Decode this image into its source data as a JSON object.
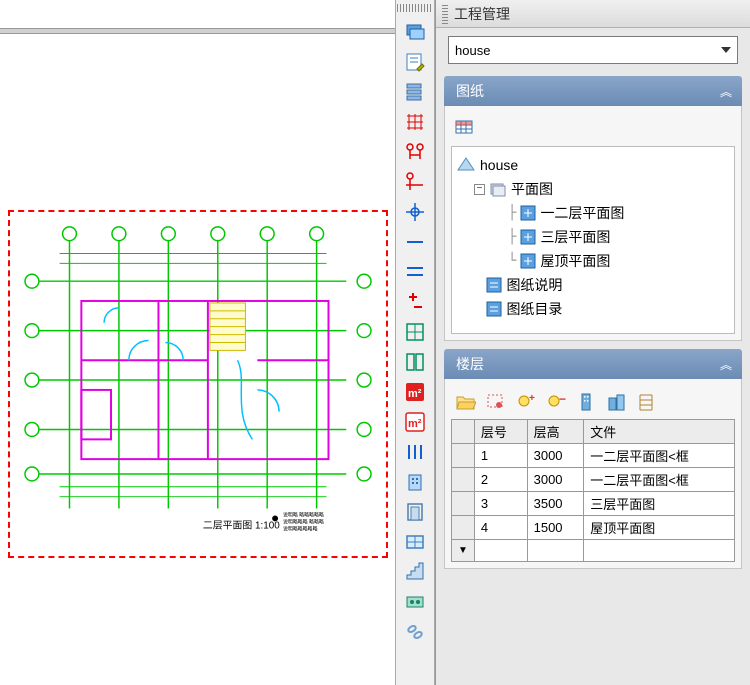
{
  "panel": {
    "title": "工程管理",
    "dropdown_value": "house"
  },
  "sections": {
    "drawings": {
      "title": "图纸"
    },
    "floors": {
      "title": "楼层"
    }
  },
  "tree": {
    "root": "house",
    "group": "平面图",
    "items": [
      "一二层平面图",
      "三层平面图",
      "屋顶平面图"
    ],
    "extras": [
      "图纸说明",
      "图纸目录"
    ]
  },
  "floor_table": {
    "headers": [
      "层号",
      "层高",
      "文件"
    ],
    "rows": [
      {
        "num": "1",
        "height": "3000",
        "file": "一二层平面图<框"
      },
      {
        "num": "2",
        "height": "3000",
        "file": "一二层平面图<框"
      },
      {
        "num": "3",
        "height": "3500",
        "file": "三层平面图"
      },
      {
        "num": "4",
        "height": "1500",
        "file": "屋顶平面图"
      }
    ]
  },
  "floorplan": {
    "caption": "二层平面图 1:100"
  },
  "tool_icons": [
    "layer-icon",
    "note-icon",
    "sheets-icon",
    "grid-icon",
    "dimension-icon",
    "axis-icon",
    "target-icon",
    "hline-icon",
    "vline-icon",
    "plusminus-icon",
    "plan-icon",
    "split-icon",
    "m2-red-icon",
    "m2-outline-icon",
    "bars-icon",
    "building-icon",
    "door-icon",
    "window-icon",
    "stairs-icon",
    "component-icon",
    "link-icon"
  ]
}
